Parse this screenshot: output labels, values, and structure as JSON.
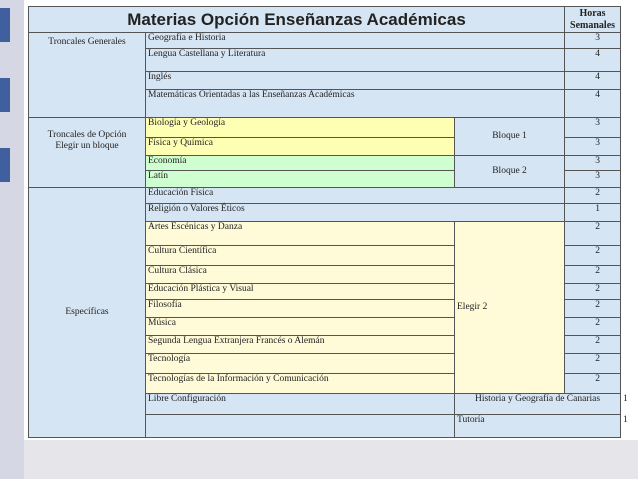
{
  "title": "Materias Opción Enseñanzas Académicas",
  "hours_header_line1": "Horas",
  "hours_header_line2": "Semanales",
  "groups": {
    "troncales_generales": "Troncales Generales",
    "troncales_opcion_line1": "Troncales de Opción",
    "troncales_opcion_line2": "Elegir un bloque",
    "especificas": "Específicas",
    "libre": "Libre Configuración"
  },
  "blocks": {
    "bloque1": "Bloque 1",
    "bloque2": "Bloque 2",
    "elegir2": "Elegir 2"
  },
  "rows": [
    {
      "subject": "Geografía e Historia",
      "hours": "3"
    },
    {
      "subject": "Lengua Castellana y Literatura",
      "hours": "4"
    },
    {
      "subject": "Inglés",
      "hours": "4"
    },
    {
      "subject": "Matemáticas Orientadas a las Enseñanzas Académicas",
      "hours": "4"
    },
    {
      "subject": "Biología y Geología",
      "hours": "3"
    },
    {
      "subject": "Física y Química",
      "hours": "3"
    },
    {
      "subject": "Economía",
      "hours": "3"
    },
    {
      "subject": "Latín",
      "hours": "3"
    },
    {
      "subject": "Educación Física",
      "hours": "2"
    },
    {
      "subject": "Religión o Valores Éticos",
      "hours": "1"
    },
    {
      "subject": "Artes Escénicas y Danza",
      "hours": "2"
    },
    {
      "subject": "Cultura Científica",
      "hours": "2"
    },
    {
      "subject": "Cultura Clásica",
      "hours": "2"
    },
    {
      "subject": "Educación Plástica y Visual",
      "hours": "2"
    },
    {
      "subject": "Filosofía",
      "hours": "2"
    },
    {
      "subject": "Música",
      "hours": "2"
    },
    {
      "subject": "Segunda Lengua Extranjera Francés o Alemán",
      "hours": "2"
    },
    {
      "subject": "Tecnología",
      "hours": "2"
    },
    {
      "subject": "Tecnologías de la Información y Comunicación",
      "hours": "2"
    },
    {
      "subject": "Historia y Geografía de Canarias",
      "hours": "1"
    },
    {
      "subject": "Tutoría",
      "hours": "1"
    }
  ]
}
